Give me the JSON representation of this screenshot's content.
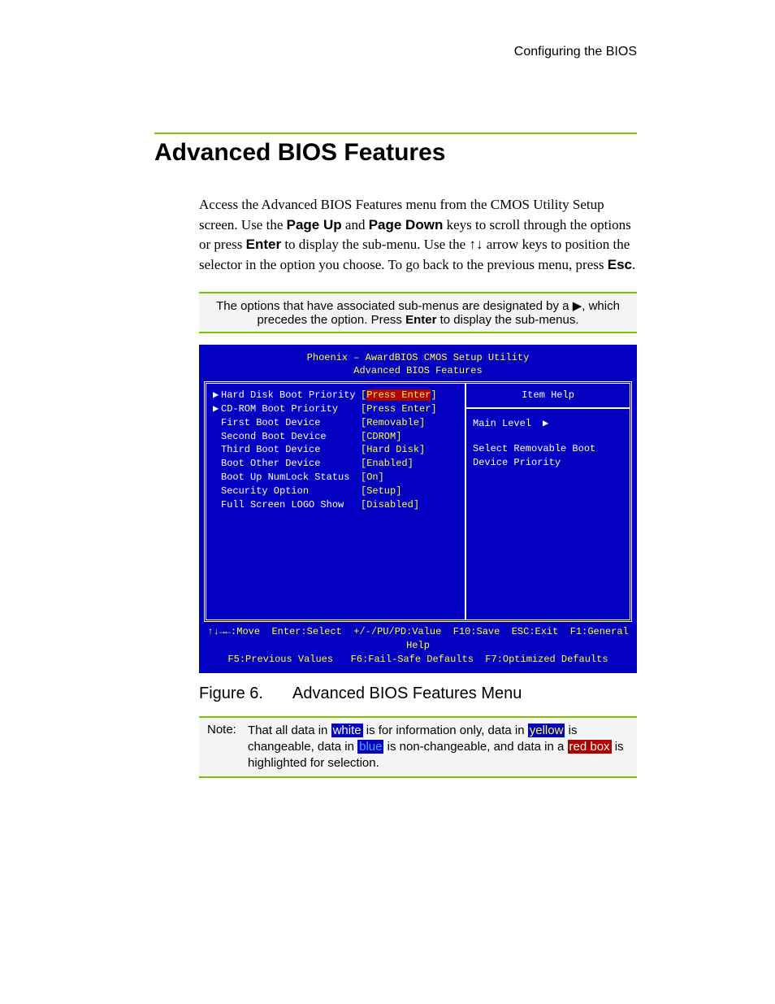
{
  "running_header": "Configuring the BIOS",
  "section_title": "Advanced BIOS Features",
  "paragraph": {
    "t1": "Access the Advanced BIOS Features menu from the CMOS Utility Setup screen. Use the ",
    "b1": "Page Up",
    "t2": " and ",
    "b2": "Page Down",
    "t3": " keys to scroll through the options or press ",
    "b3": "Enter",
    "t4": " to display the sub-menu. Use the ",
    "arrows": "↑↓",
    "t5": " arrow keys to position the selector in the option you choose. To go back to the previous menu, press ",
    "b4": "Esc",
    "t6": "."
  },
  "infobox": {
    "t1": "The options that have associated sub-menus are designated by a ",
    "tri": "▶",
    "t2": ", which precedes the option. Press ",
    "b1": "Enter",
    "t3": " to display the sub-menus."
  },
  "bios": {
    "title_line1": "Phoenix – AwardBIOS CMOS Setup Utility",
    "title_line2": "Advanced BIOS Features",
    "options": [
      {
        "tri": true,
        "label": "Hard Disk Boot Priority",
        "value": "Press Enter",
        "hl": true
      },
      {
        "tri": true,
        "label": "CD-ROM Boot Priority",
        "value": "Press Enter",
        "hl": false
      },
      {
        "tri": false,
        "label": "First Boot Device",
        "value": "Removable",
        "hl": false
      },
      {
        "tri": false,
        "label": "Second Boot Device",
        "value": "CDROM",
        "hl": false
      },
      {
        "tri": false,
        "label": "Third Boot Device",
        "value": "Hard Disk",
        "hl": false
      },
      {
        "tri": false,
        "label": "Boot Other Device",
        "value": "Enabled",
        "hl": false
      },
      {
        "tri": false,
        "label": "Boot Up NumLock Status",
        "value": "On",
        "hl": false
      },
      {
        "tri": false,
        "label": "Security Option",
        "value": "Setup",
        "hl": false
      },
      {
        "tri": false,
        "label": "Full Screen LOGO Show",
        "value": "Disabled",
        "hl": false
      }
    ],
    "help": {
      "title": "Item Help",
      "level": "Main Level",
      "tri": "▶",
      "desc": "Select Removable Boot Device Priority"
    },
    "footer_line1": "↑↓→←:Move  Enter:Select  +/-/PU/PD:Value  F10:Save  ESC:Exit  F1:General Help",
    "footer_line2": "F5:Previous Values   F6:Fail-Safe Defaults  F7:Optimized Defaults"
  },
  "figure": {
    "number": "Figure 6.",
    "title": "Advanced BIOS Features Menu"
  },
  "note": {
    "label": "Note:",
    "t1": "That all data in ",
    "sw1": "white",
    "t2": " is for information only, data in ",
    "sw2": "yellow",
    "t3": " is changeable, data in ",
    "sw3": "blue",
    "t4": " is non-changeable, and data in a ",
    "sw4": "red box",
    "t5": " is highlighted for selection."
  }
}
